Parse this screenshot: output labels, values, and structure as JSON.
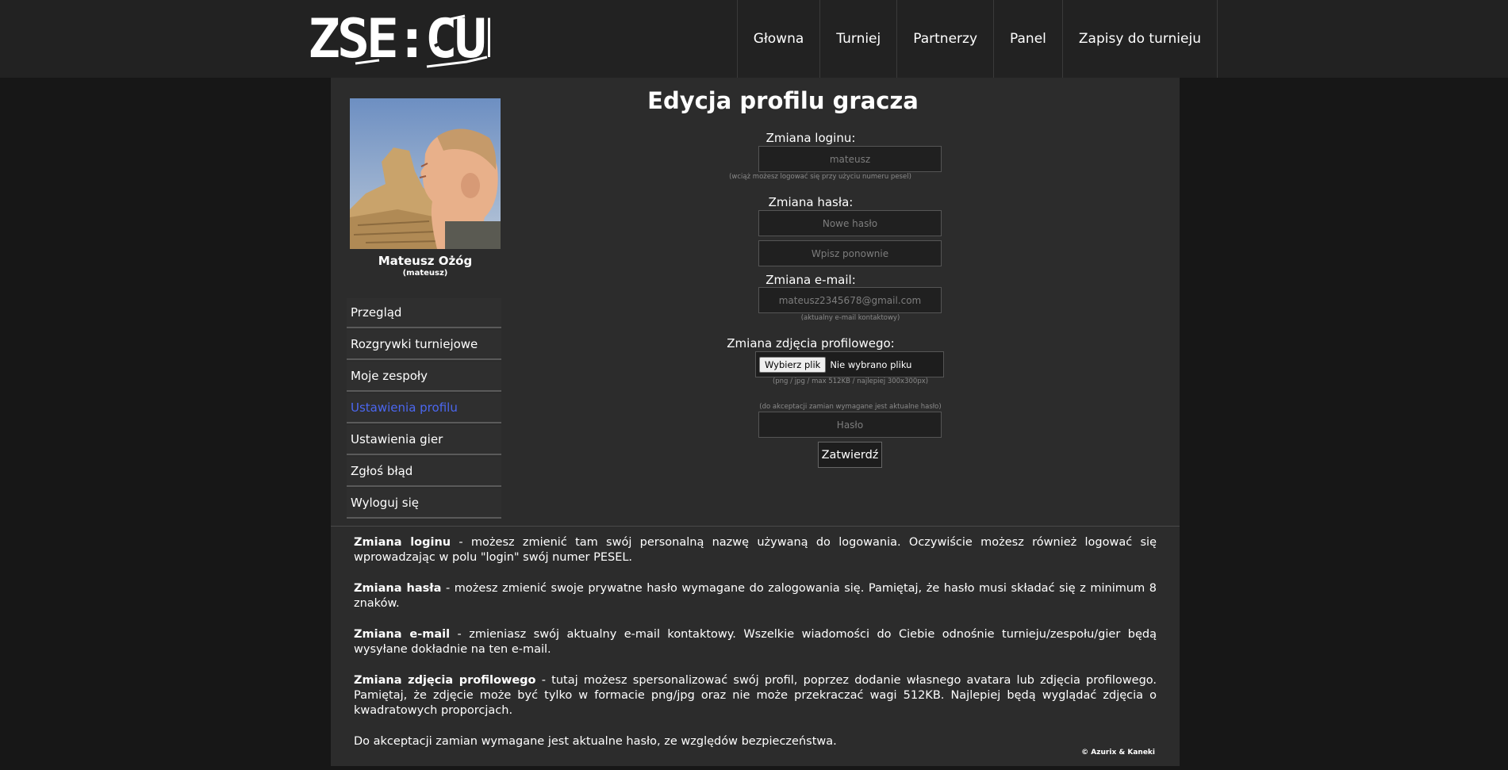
{
  "logo": {
    "text": "ZSE:CUP;"
  },
  "nav": {
    "items": [
      {
        "label": "Głowna"
      },
      {
        "label": "Turniej"
      },
      {
        "label": "Partnerzy"
      },
      {
        "label": "Panel"
      },
      {
        "label": "Zapisy do turnieju"
      }
    ]
  },
  "profile": {
    "name": "Mateusz Ożóg",
    "login": "(mateusz)"
  },
  "menu": {
    "items": [
      {
        "label": "Przegląd"
      },
      {
        "label": "Rozgrywki turniejowe"
      },
      {
        "label": "Moje zespoły"
      },
      {
        "label": "Ustawienia profilu",
        "active": true
      },
      {
        "label": "Ustawienia gier"
      },
      {
        "label": "Zgłoś błąd"
      },
      {
        "label": "Wyloguj się"
      }
    ]
  },
  "form": {
    "title": "Edycja profilu gracza",
    "login_label": "Zmiana loginu:",
    "login_placeholder": "mateusz",
    "login_hint": "(wciąż możesz logować się przy użyciu numeru pesel)",
    "password_label": "Zmiana hasła:",
    "password_placeholder": "Nowe hasło",
    "password_repeat_placeholder": "Wpisz ponownie",
    "email_label": "Zmiana e-mail:",
    "email_placeholder": "mateusz2345678@gmail.com",
    "email_hint": "(aktualny e-mail kontaktowy)",
    "photo_label": "Zmiana zdjęcia profilowego:",
    "file_button": "Wybierz plik",
    "file_status": "Nie wybrano pliku",
    "photo_hint": "(png / jpg / max 512KB / najlepiej 300x300px)",
    "confirm_hint": "(do akceptacji zamian wymagane jest aktualne hasło)",
    "confirm_placeholder": "Hasło",
    "submit_label": "Zatwierdź"
  },
  "description": {
    "login_title": "Zmiana loginu",
    "login_text": " - możesz zmienić tam swój personalną nazwę używaną do logowania. Oczywiście możesz również logować się wprowadzając w polu \"login\" swój numer PESEL.",
    "password_title": "Zmiana hasła",
    "password_text": " - możesz zmienić swoje prywatne hasło wymagane do zalogowania się. Pamiętaj, że hasło musi składać się z minimum 8 znaków.",
    "email_title": "Zmiana e-mail",
    "email_text": " - zmieniasz swój aktualny e-mail kontaktowy. Wszelkie wiadomości do Ciebie odnośnie turnieju/zespołu/gier będą wysyłane dokładnie na ten e-mail.",
    "photo_title": "Zmiana zdjęcia profilowego",
    "photo_text": " - tutaj możesz spersonalizować swój profil, poprzez dodanie własnego avatara lub zdjęcia profilowego. Pamiętaj, że zdjęcie może być tylko w formacie png/jpg oraz nie może przekraczać wagi 512KB. Najlepiej będą wyglądać zdjęcia o kwadratowych proporcjach.",
    "footer_text": "Do akceptacji zamian wymagane jest aktualne hasło, ze względów bezpieczeństwa."
  },
  "copyright": "© Azurix & Kaneki"
}
